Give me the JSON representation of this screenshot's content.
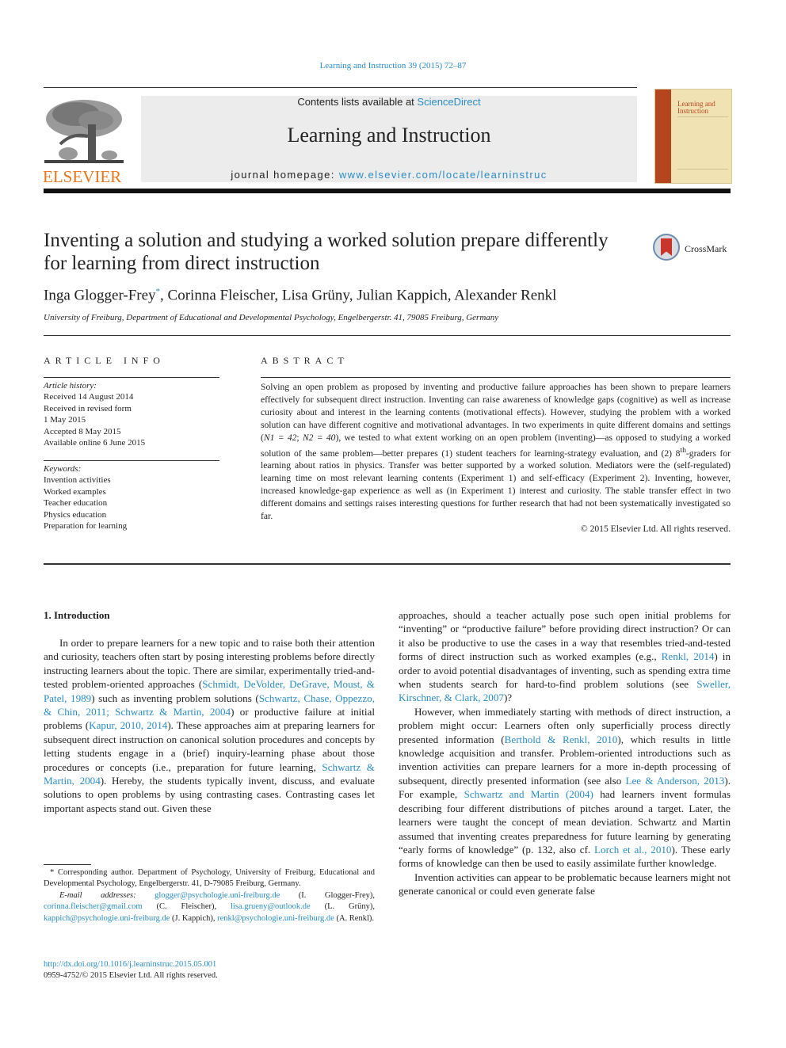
{
  "header": {
    "citation": "Learning and Instruction 39 (2015) 72–87",
    "publisher_logo_text": "ELSEVIER",
    "contents_prefix": "Contents lists available at ",
    "contents_link": "ScienceDirect",
    "journal_title": "Learning and Instruction",
    "homepage_prefix": "journal homepage: ",
    "homepage_link": "www.elsevier.com/locate/learninstruc",
    "cover_title_line1": "Learning and",
    "cover_title_line2": "Instruction",
    "crossmark_label": "CrossMark"
  },
  "article": {
    "title": "Inventing a solution and studying a worked solution prepare differently for learning from direct instruction",
    "authors": [
      {
        "name": "Inga Glogger-Frey",
        "mark": "*"
      },
      {
        "name": "Corinna Fleischer",
        "mark": ""
      },
      {
        "name": "Lisa Grüny",
        "mark": ""
      },
      {
        "name": "Julian Kappich",
        "mark": ""
      },
      {
        "name": "Alexander Renkl",
        "mark": ""
      }
    ],
    "affiliation": "University of Freiburg, Department of Educational and Developmental Psychology, Engelbergerstr. 41, 79085 Freiburg, Germany"
  },
  "article_info": {
    "heading": "ARTICLE INFO",
    "history_label": "Article history:",
    "history": [
      "Received 14 August 2014",
      "Received in revised form",
      "1 May 2015",
      "Accepted 8 May 2015",
      "Available online 6 June 2015"
    ],
    "keywords_label": "Keywords:",
    "keywords": [
      "Invention activities",
      "Worked examples",
      "Teacher education",
      "Physics education",
      "Preparation for learning"
    ]
  },
  "abstract": {
    "heading": "ABSTRACT",
    "part1": "Solving an open problem as proposed by inventing and productive failure approaches has been shown to prepare learners effectively for subsequent direct instruction. Inventing can raise awareness of knowledge gaps (cognitive) as well as increase curiosity about and interest in the learning contents (motivational effects). However, studying the problem with a worked solution can have different cognitive and motivational advantages. In two experiments in quite different domains and settings (",
    "n1": "N1 = 42",
    "sep": "; ",
    "n2": "N2 = 40",
    "part2": "), we tested to what extent working on an open problem (inventing)—as opposed to studying a worked solution of the same problem—better prepares (1) student teachers for learning-strategy evaluation, and (2) 8",
    "sup": "th",
    "part3": "-graders for learning about ratios in physics. Transfer was better supported by a worked solution. Mediators were the (self-regulated) learning time on most relevant learning contents (Experiment 1) and self-efficacy (Experiment 2). Inventing, however, increased knowledge-gap experience as well as (in Experiment 1) interest and curiosity. The stable transfer effect in two different domains and settings raises interesting questions for further research that had not been systematically investigated so far.",
    "copyright": "© 2015 Elsevier Ltd. All rights reserved."
  },
  "body": {
    "section_heading": "1.  Introduction",
    "left": [
      {
        "t": "In order to prepare learners for a new topic and to raise both their attention and curiosity, teachers often start by posing interesting problems before directly instructing learners about the topic. There are similar, experimentally tried-and-tested problem-oriented approaches ("
      },
      {
        "l": "Schmidt, DeVolder, DeGrave, Moust, & Patel, 1989"
      },
      {
        "t": ") such as inventing problem solutions ("
      },
      {
        "l": "Schwartz, Chase, Oppezzo, & Chin, 2011; Schwartz & Martin, 2004"
      },
      {
        "t": ") or productive failure at initial problems ("
      },
      {
        "l": "Kapur, 2010, 2014"
      },
      {
        "t": "). These approaches aim at preparing learners for subsequent direct instruction on canonical solution procedures and concepts by letting students engage in a (brief) inquiry-learning phase about those procedures or concepts (i.e., preparation for future learning, "
      },
      {
        "l": "Schwartz & Martin, 2004"
      },
      {
        "t": "). Hereby, the students typically invent, discuss, and evaluate solutions to open problems by using contrasting cases. Contrasting cases let important aspects stand out. Given these"
      }
    ],
    "right_p1": [
      {
        "t": "approaches, should a teacher actually pose such open initial problems for “inventing” or “productive failure” before providing direct instruction? Or can it also be productive to use the cases in a way that resembles tried-and-tested forms of direct instruction such as worked examples (e.g., "
      },
      {
        "l": "Renkl, 2014"
      },
      {
        "t": ") in order to avoid potential disadvantages of inventing, such as spending extra time when students search for hard-to-find problem solutions (see "
      },
      {
        "l": "Sweller, Kirschner, & Clark, 2007"
      },
      {
        "t": ")?"
      }
    ],
    "right_p2": [
      {
        "t": "However, when immediately starting with methods of direct instruction, a problem might occur: Learners often only superficially process directly presented information ("
      },
      {
        "l": "Berthold & Renkl, 2010"
      },
      {
        "t": "), which results in little knowledge acquisition and transfer. Problem-oriented introductions such as invention activities can prepare learners for a more in-depth processing of subsequent, directly presented information (see also "
      },
      {
        "l": "Lee & Anderson, 2013"
      },
      {
        "t": "). For example, "
      },
      {
        "l": "Schwartz and Martin (2004)"
      },
      {
        "t": " had learners invent formulas describing four different distributions of pitches around a target. Later, the learners were taught the concept of mean deviation. Schwartz and Martin assumed that inventing creates preparedness for future learning by generating “early forms of knowledge” (p. 132, also cf. "
      },
      {
        "l": "Lorch et al., 2010"
      },
      {
        "t": "). These early forms of knowledge can then be used to easily assimilate further knowledge."
      }
    ],
    "right_p3": [
      {
        "t": "Invention activities can appear to be problematic because learners might not generate canonical or could even generate false"
      }
    ]
  },
  "footnote": {
    "corresponding": "* Corresponding author. Department of Psychology, University of Freiburg, Educational and Developmental Psychology, Engelbergerstr. 41, D-79085 Freiburg, Germany.",
    "email_label": "E-mail addresses: ",
    "emails": [
      {
        "addr": "glogger@psychologie.uni-freiburg.de",
        "who": " (I. Glogger-Frey), "
      },
      {
        "addr": "corinna.fleischer@gmail.com",
        "who": " (C. Fleischer), "
      },
      {
        "addr": "lisa.grueny@outlook.de",
        "who": " (L. Grüny), "
      },
      {
        "addr": "kappich@psychologie.uni-freiburg.de",
        "who": " (J. Kappich), "
      },
      {
        "addr": "renkl@psychologie.uni-freiburg.de",
        "who": " (A. Renkl)."
      }
    ],
    "doi": "http://dx.doi.org/10.1016/j.learninstruc.2015.05.001",
    "issn": "0959-4752/© 2015 Elsevier Ltd. All rights reserved."
  },
  "colors": {
    "link": "#2b8cc4",
    "elsevier_orange": "#e8761a",
    "banner_gray": "#ececec",
    "cover_spine": "#b4451e",
    "cover_bg": "#f1e2b3"
  }
}
